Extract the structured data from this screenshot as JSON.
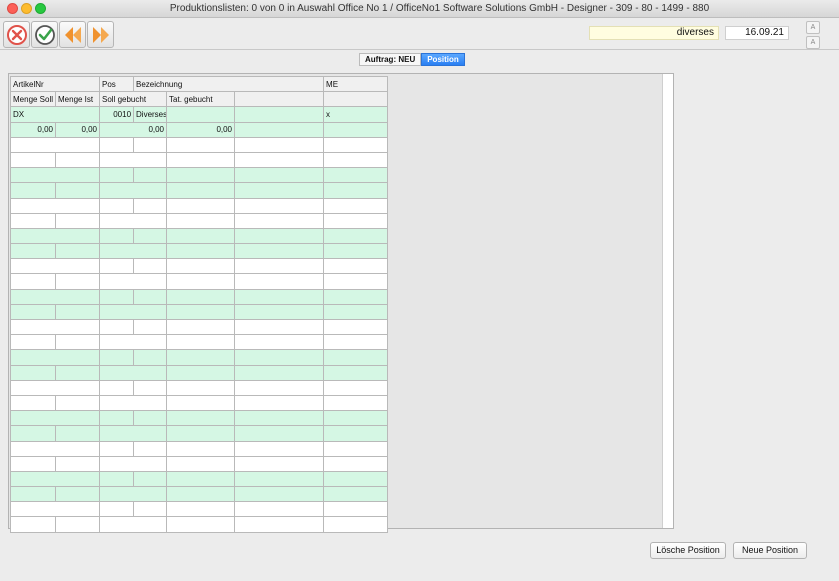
{
  "window": {
    "title": "Produktionslisten: 0 von 0 in Auswahl Office No 1 /  OfficeNo1 Software Solutions GmbH - Designer - 309 - 80 - 1499 - 880"
  },
  "toolbar": {
    "icons": [
      "cancel-icon",
      "confirm-icon",
      "previous-icon",
      "next-icon"
    ],
    "name_value": "diverses",
    "date_value": "16.09.21",
    "font_up": "A",
    "font_down": "A"
  },
  "tabs": [
    {
      "label": "Auftrag: NEU"
    },
    {
      "label": "Position"
    }
  ],
  "table": {
    "headers_row1": [
      "ArtikelNr",
      "Pos",
      "Bezeichnung",
      "ME"
    ],
    "headers_row2": [
      "Menge Soll",
      "Menge Ist",
      "Soll gebucht",
      "Tat. gebucht"
    ],
    "rows": [
      {
        "artikelnr": "DX",
        "pos": "0010",
        "bezeichnung": "Diverses",
        "me": "x",
        "menge_soll": "0,00",
        "menge_ist": "0,00",
        "soll_gebucht": "0,00",
        "tat_gebucht": "0,00"
      }
    ]
  },
  "buttons": {
    "delete": "Lösche Position",
    "new": "Neue Position"
  },
  "colors": {
    "row_green": "#d5f7e4",
    "row_white": "#ffffff",
    "accent": "#2a7ff2",
    "name_field": "#fffde0"
  }
}
